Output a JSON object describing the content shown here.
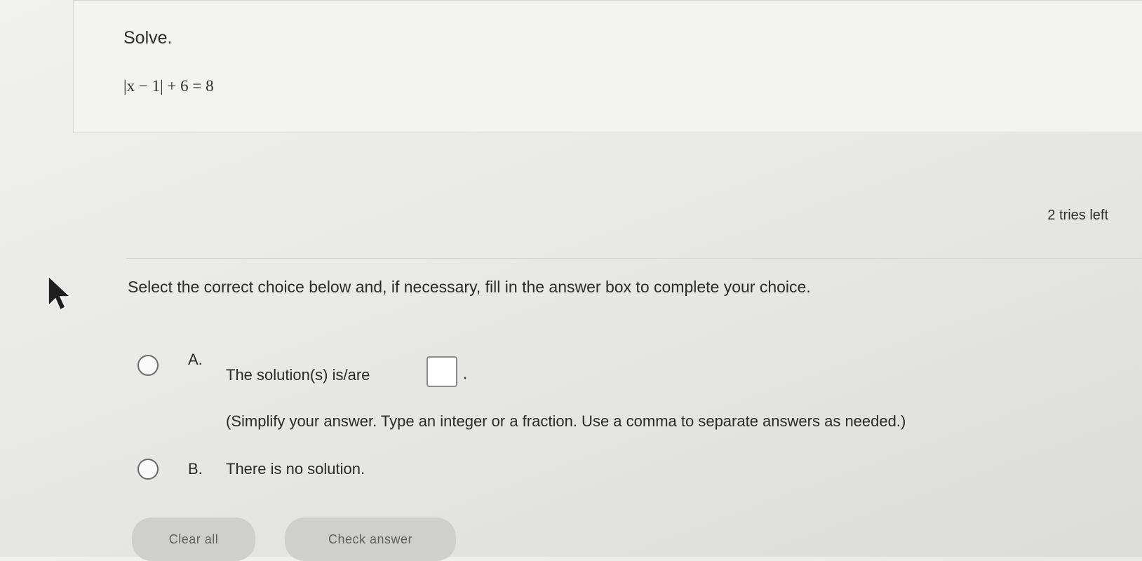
{
  "problem": {
    "instruction": "Solve.",
    "equation": "|x − 1| + 6 = 8"
  },
  "status": {
    "tries_left": "2 tries left"
  },
  "question": {
    "prompt": "Select the correct choice below and, if necessary, fill in the answer box to complete your choice.",
    "choices": [
      {
        "letter": "A.",
        "text": "The solution(s) is/are",
        "hint": "(Simplify your answer. Type an integer or a fraction. Use a comma to separate answers as needed.)"
      },
      {
        "letter": "B.",
        "text": "There is no solution."
      }
    ],
    "answer_value": ""
  },
  "buttons": {
    "clear_label": "Clear all",
    "check_label": "Check answer"
  }
}
